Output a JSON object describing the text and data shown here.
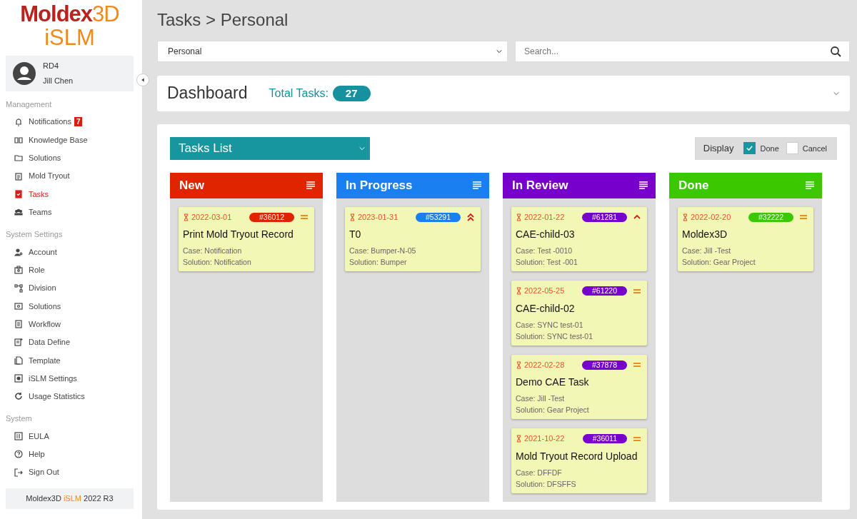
{
  "logo": {
    "brand": "Moldex",
    "accent": "3D",
    "product": "iSLM"
  },
  "user": {
    "group": "RD4",
    "name": "Jill Chen"
  },
  "sidebar": {
    "sections": [
      {
        "title": "Management",
        "items": [
          {
            "label": "Notifications",
            "selected": false,
            "badge": "7"
          },
          {
            "label": "Knowledge Base",
            "selected": false
          },
          {
            "label": "Solutions",
            "selected": false
          },
          {
            "label": "Mold Tryout",
            "selected": false
          },
          {
            "label": "Tasks",
            "selected": true
          },
          {
            "label": "Teams",
            "selected": false
          }
        ]
      },
      {
        "title": "System Settings",
        "items": [
          {
            "label": "Account",
            "selected": false
          },
          {
            "label": "Role",
            "selected": false
          },
          {
            "label": "Division",
            "selected": false
          },
          {
            "label": "Solutions",
            "selected": false
          },
          {
            "label": "Workflow",
            "selected": false
          },
          {
            "label": "Data Define",
            "selected": false
          },
          {
            "label": "Template",
            "selected": false
          },
          {
            "label": "iSLM Settings",
            "selected": false
          },
          {
            "label": "Usage Statistics",
            "selected": false
          }
        ]
      },
      {
        "title": "System",
        "items": [
          {
            "label": "EULA",
            "selected": false
          },
          {
            "label": "Help",
            "selected": false
          },
          {
            "label": "Sign Out",
            "selected": false
          }
        ]
      }
    ],
    "version": {
      "brand": "Moldex3D ",
      "product": "iSLM",
      "release": " 2022 R3"
    }
  },
  "page_title": "Tasks > Personal",
  "filter": {
    "scope": "Personal",
    "search_placeholder": "Search..."
  },
  "dashboard": {
    "title": "Dashboard",
    "total_label": "Total Tasks:",
    "total": "27",
    "expanded": false
  },
  "board": {
    "view": "Tasks List",
    "display_label": "Display",
    "display_options": [
      {
        "label": "Done",
        "checked": true
      },
      {
        "label": "Cancel",
        "checked": false
      }
    ],
    "columns": [
      {
        "title": "New",
        "color": "#e02400",
        "cards": [
          {
            "date": "2022-03-01",
            "id": "#36012",
            "kind": "medium",
            "title": "Print Mold Tryout Record",
            "case": "Case: Notification",
            "solution": "Solution: Notification"
          }
        ]
      },
      {
        "title": "In Progress",
        "color": "#1a7ff0",
        "cards": [
          {
            "date": "2023-01-31",
            "id": "#53291",
            "kind": "urgent",
            "title": "T0",
            "case": "Case: Bumper-N-05",
            "solution": "Solution: Bumper"
          }
        ]
      },
      {
        "title": "In Review",
        "color": "#7800cc",
        "cards": [
          {
            "date": "2022-01-22",
            "id": "#61281",
            "kind": "high",
            "title": "CAE-child-03",
            "case": "Case: Test -0010",
            "solution": "Solution: Test -001"
          },
          {
            "date": "2022-05-25",
            "id": "#61220",
            "kind": "medium",
            "title": "CAE-child-02",
            "case": "Case: SYNC test-01",
            "solution": "Solution: SYNC test-01"
          },
          {
            "date": "2022-02-28",
            "id": "#37878",
            "kind": "medium",
            "title": "Demo CAE Task",
            "case": "Case: Jill -Test",
            "solution": "Solution: Gear Project"
          },
          {
            "date": "2021-10-22",
            "id": "#36011",
            "kind": "medium",
            "title": "Mold Tryout Record Upload",
            "case": "Case: DFFDF",
            "solution": "Solution: DFSFFS"
          }
        ]
      },
      {
        "title": "Done",
        "color": "#3cc800",
        "cards": [
          {
            "date": "2022-02-20",
            "id": "#32222",
            "kind": "medium",
            "title": "Moldex3D",
            "case": "Case: Jill -Test",
            "solution": "Solution: Gear Project"
          }
        ]
      }
    ]
  }
}
